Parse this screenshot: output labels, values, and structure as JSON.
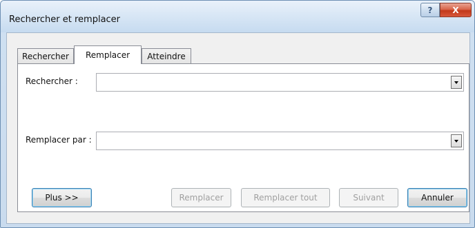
{
  "window": {
    "title": "Rechercher et remplacer",
    "help_label": "?",
    "close_label": "X"
  },
  "tabs": [
    {
      "label": "Rechercher",
      "active": false
    },
    {
      "label": "Remplacer",
      "active": true
    },
    {
      "label": "Atteindre",
      "active": false
    }
  ],
  "find": {
    "label": "Rechercher :",
    "value": ""
  },
  "replace": {
    "label": "Remplacer par :",
    "value": ""
  },
  "buttons": {
    "more": "Plus >>",
    "replace": "Remplacer",
    "replace_all": "Remplacer tout",
    "next": "Suivant",
    "cancel": "Annuler"
  },
  "colors": {
    "titlebar": "#cfe0f1",
    "close_button": "#c2391b",
    "dialog_face": "#f0f0f0"
  }
}
